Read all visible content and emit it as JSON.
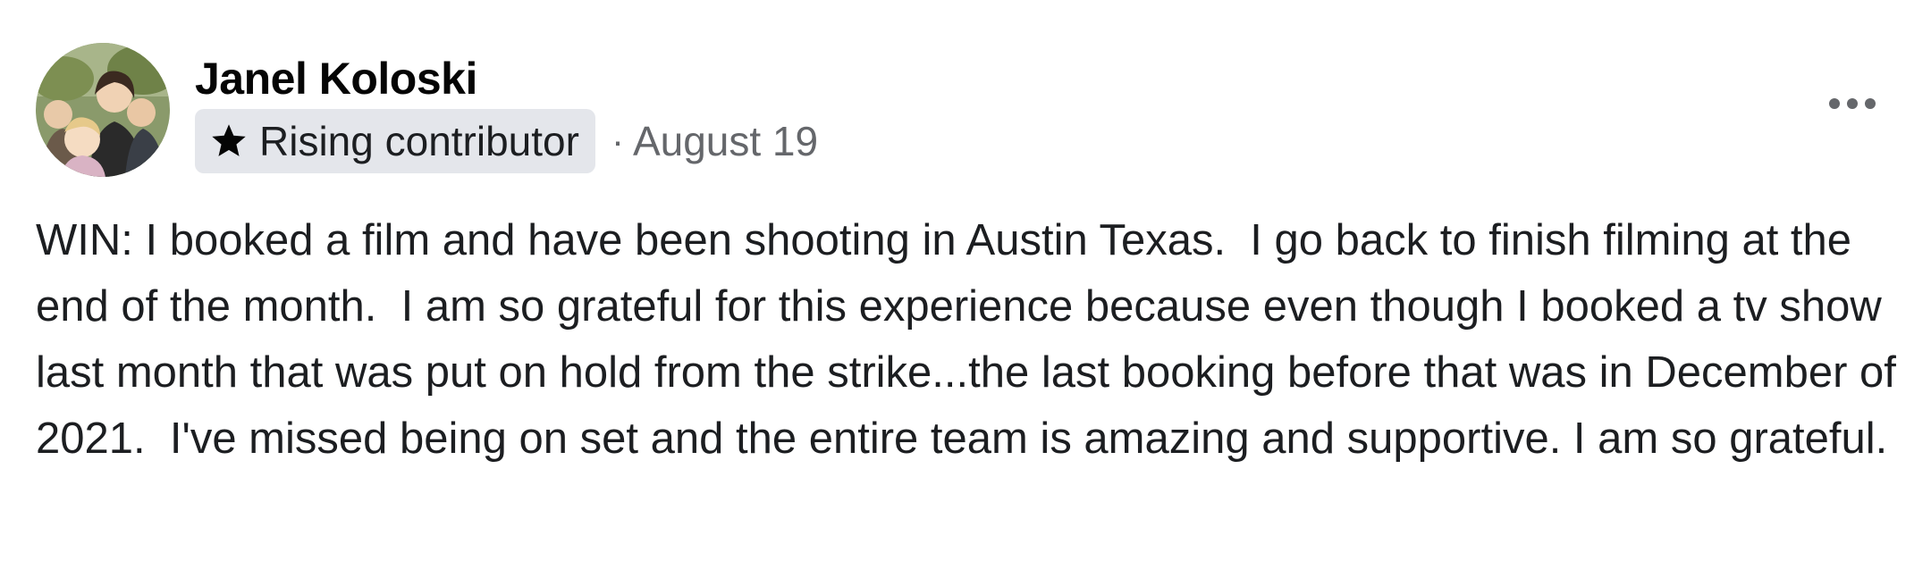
{
  "post": {
    "author": "Janel Koloski",
    "badge": {
      "icon": "star-icon",
      "label": "Rising contributor"
    },
    "separator": "·",
    "date": "August 19",
    "more_icon": "more-options-icon",
    "text": "WIN: I booked a film and have been shooting in Austin Texas.  I go back to finish filming at the end of the month.  I am so grateful for this experience because even though I booked a tv show last month that was put on hold from the strike...the last booking before that was in December of 2021.  I've missed being on set and the entire team is amazing and supportive. I am so grateful."
  },
  "colors": {
    "badge_bg": "#e4e6eb",
    "secondary_text": "#65676b",
    "primary_text": "#1c1e21"
  }
}
